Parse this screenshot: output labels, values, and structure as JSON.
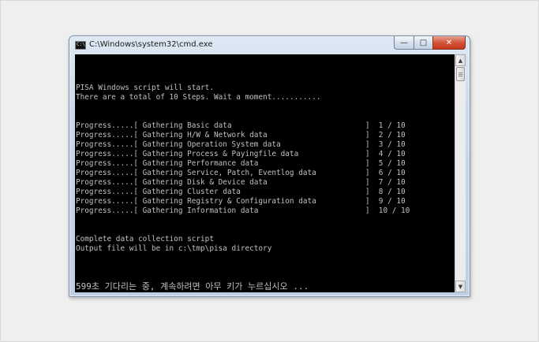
{
  "window": {
    "title": "C:\\Windows\\system32\\cmd.exe",
    "icon": "cmd-icon",
    "controls": {
      "minimize": "—",
      "maximize": "□",
      "close": "✕"
    }
  },
  "console": {
    "lines": [
      "PISA Windows script will start.",
      "There are a total of 10 Steps. Wait a moment...........",
      "",
      "",
      "Progress.....[ Gathering Basic data                              ]  1 / 10",
      "Progress.....[ Gathering H/W & Network data                      ]  2 / 10",
      "Progress.....[ Gathering Operation System data                   ]  3 / 10",
      "Progress.....[ Gathering Process & Payingfile data               ]  4 / 10",
      "Progress.....[ Gathering Performance data                        ]  5 / 10",
      "Progress.....[ Gathering Service, Patch, Eventlog data           ]  6 / 10",
      "Progress.....[ Gathering Disk & Device data                      ]  7 / 10",
      "Progress.....[ Gathering Cluster data                            ]  8 / 10",
      "Progress.....[ Gathering Registry & Configuration data           ]  9 / 10",
      "Progress.....[ Gathering Information data                        ]  10 / 10",
      "",
      "",
      "Complete data collection script",
      "Output file will be in c:\\tmp\\pisa directory"
    ],
    "prompt": "599초 기다리는 중, 계속하려면 아무 키가 누르십시오 ..."
  },
  "colors": {
    "console_bg": "#000000",
    "console_text": "#c0c0c0",
    "close_button": "#c3371b"
  }
}
